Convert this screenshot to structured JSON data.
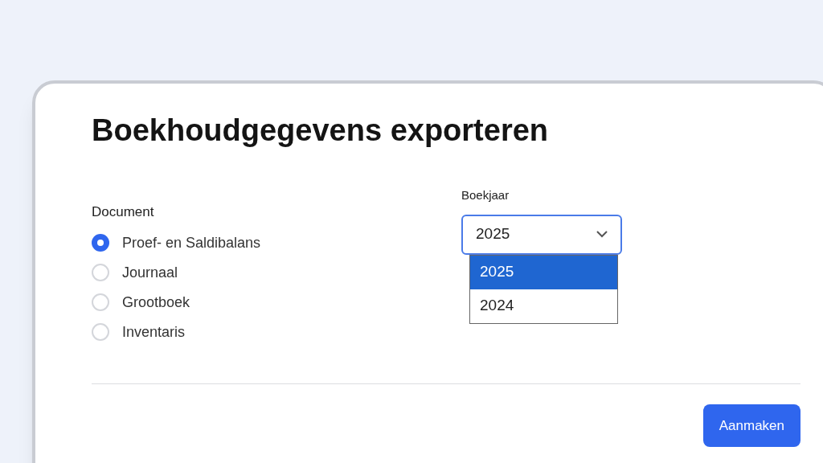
{
  "dialog": {
    "title": "Boekhoudgegevens exporteren"
  },
  "document": {
    "label": "Document",
    "options": [
      {
        "label": "Proef- en Saldibalans",
        "selected": true
      },
      {
        "label": "Journaal",
        "selected": false
      },
      {
        "label": "Grootboek",
        "selected": false
      },
      {
        "label": "Inventaris",
        "selected": false
      }
    ]
  },
  "year": {
    "label": "Boekjaar",
    "value": "2025",
    "expanded": true,
    "options": [
      {
        "label": "2025",
        "selected": true
      },
      {
        "label": "2024",
        "selected": false
      }
    ]
  },
  "buttons": [
    "Aanmaken"
  ]
}
